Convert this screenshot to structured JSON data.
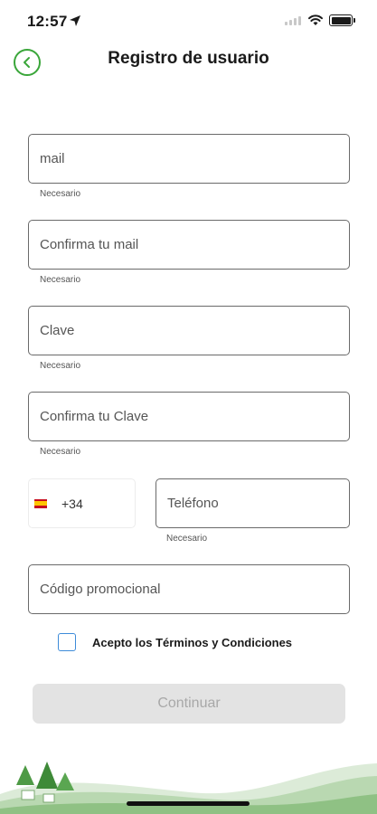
{
  "status_bar": {
    "time": "12:57"
  },
  "header": {
    "title": "Registro de usuario",
    "accent_color": "#3aa63a"
  },
  "form": {
    "email": {
      "placeholder": "mail",
      "helper": "Necesario"
    },
    "confirm_email": {
      "placeholder": "Confirma tu mail",
      "helper": "Necesario"
    },
    "password": {
      "placeholder": "Clave",
      "helper": "Necesario"
    },
    "confirm_password": {
      "placeholder": "Confirma tu Clave",
      "helper": "Necesario"
    },
    "phone": {
      "country_flag": "spain-flag-icon",
      "prefix": "+34",
      "placeholder": "Teléfono",
      "helper": "Necesario"
    },
    "promo_code": {
      "placeholder": "Código promocional"
    },
    "terms": {
      "label": "Acepto los Términos y Condiciones",
      "checked": false
    },
    "continue_label": "Continuar"
  }
}
